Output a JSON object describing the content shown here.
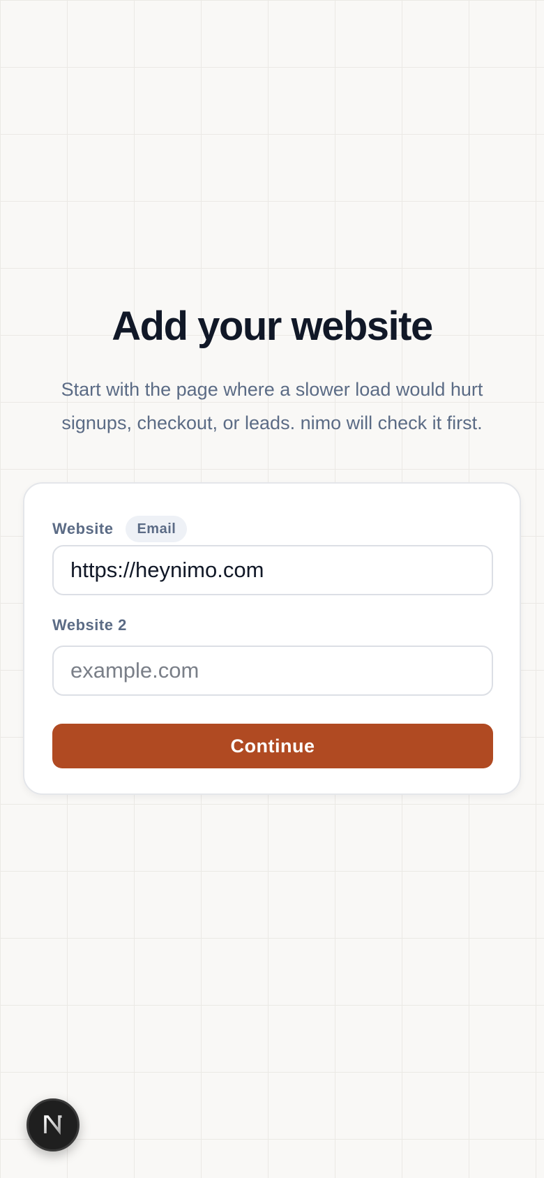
{
  "header": {
    "title": "Add your website",
    "subtitle": "Start with the page where a slower load would hurt signups, checkout, or leads. nimo will check it first."
  },
  "form": {
    "website_label": "Website",
    "email_chip": "Email",
    "website_value": "https://heynimo.com",
    "website2_label": "Website 2",
    "website2_placeholder": "example.com",
    "website2_value": "",
    "continue_label": "Continue"
  },
  "theme": {
    "accent": "#b04a22",
    "background": "#f9f8f6",
    "heading_color": "#111827",
    "muted_text": "#5b6b85"
  },
  "dev_badge": {
    "icon": "nextjs-logo-icon"
  }
}
